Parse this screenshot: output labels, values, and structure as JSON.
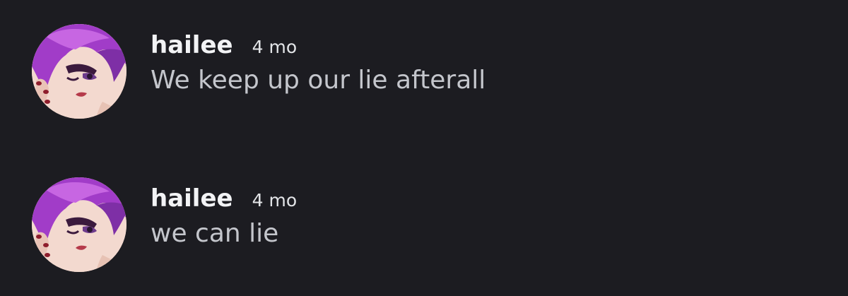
{
  "colors": {
    "background": "#1c1c21",
    "username": "#f2f3f5",
    "timestamp": "#e3e5e8",
    "message_text": "#c4c6cc",
    "avatar_hair": "#a13cc8"
  },
  "messages": [
    {
      "author": "hailee",
      "timestamp": "4 mo",
      "text": "We keep up our lie afterall",
      "avatar_icon": "user-avatar"
    },
    {
      "author": "hailee",
      "timestamp": "4 mo",
      "text": "we can lie",
      "avatar_icon": "user-avatar"
    }
  ]
}
